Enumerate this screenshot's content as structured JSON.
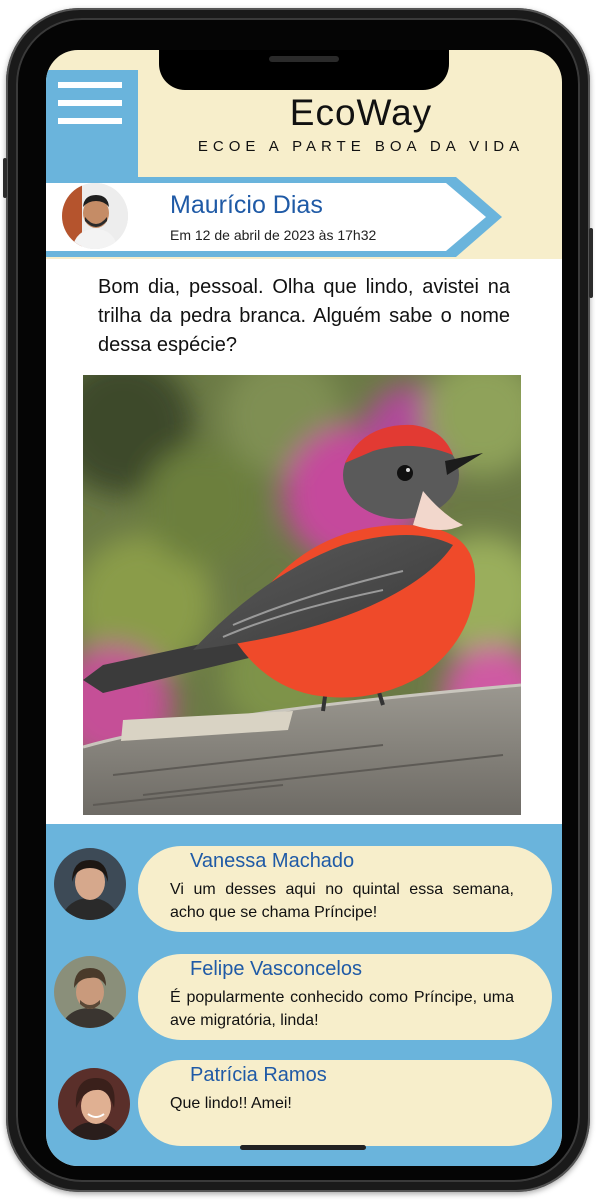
{
  "app": {
    "title": "EcoWay",
    "tagline": "ECOE A PARTE BOA DA VIDA"
  },
  "colors": {
    "accent_blue": "#6ab4dc",
    "cream": "#f7eecb",
    "name_blue": "#1f5aa6"
  },
  "icons": {
    "menu": "hamburger-menu-icon"
  },
  "post": {
    "author": "Maurício Dias",
    "date": "Em 12 de abril de 2023 às 17h32",
    "text": "Bom dia, pessoal. Olha que lindo, avistei na trilha da pedra branca. Alguém sabe o nome dessa espécie?"
  },
  "comments": [
    {
      "author": "Vanessa Machado",
      "text": "Vi um desses aqui no quintal essa semana, acho que se chama Príncipe!"
    },
    {
      "author": "Felipe Vasconcelos",
      "text": "É popularmente conhecido como Príncipe, uma ave migratória, linda!"
    },
    {
      "author": "Patrícia Ramos",
      "text": "Que lindo!! Amei!"
    }
  ]
}
